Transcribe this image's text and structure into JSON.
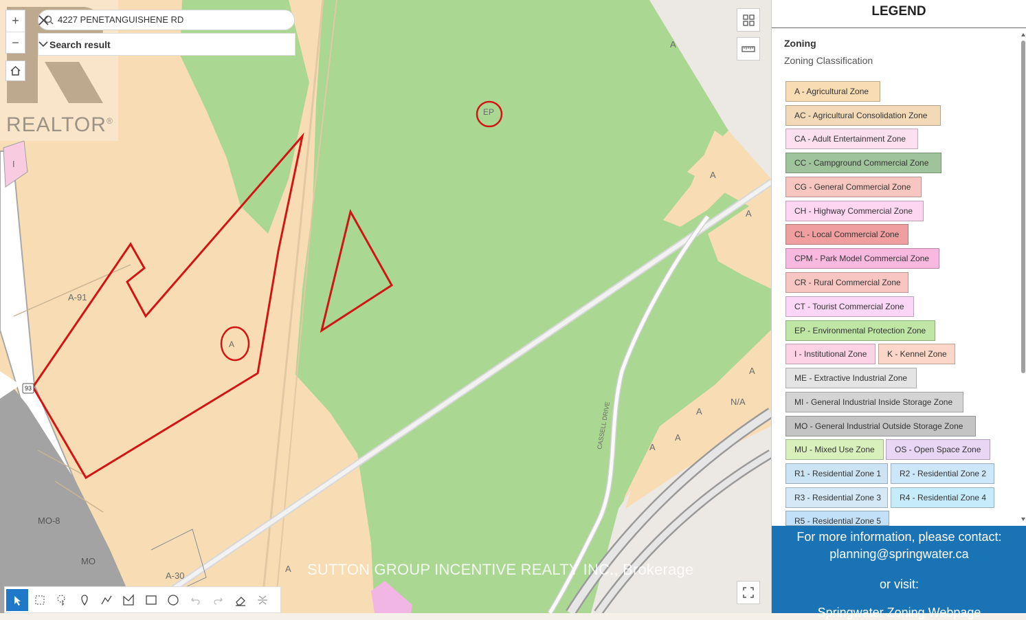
{
  "search": {
    "value": "4227 PENETANGUISHENE RD",
    "result_label": "Search result"
  },
  "zoom": {
    "in_label": "+",
    "out_label": "−"
  },
  "watermark": {
    "logo_text": "REALTOR",
    "logo_mark": "®",
    "brokerage": "SUTTON GROUP INCENTIVE REALTY INC., Brokerage"
  },
  "map_labels": {
    "ep": "EP",
    "a_circle": "A",
    "a91": "A-91",
    "road93": "93",
    "i": "I",
    "mo8": "MO-8",
    "mo": "MO",
    "a30": "A-30",
    "a_bottom": "A",
    "a_topright": "A",
    "a_right1": "A",
    "a_right2": "A",
    "a_right3": "A",
    "na": "N/A",
    "a_s1": "A",
    "a_s2": "A",
    "a_s3": "A",
    "cassell": "CASSELL DRIVE"
  },
  "legend": {
    "title": "LEGEND",
    "section": "Zoning",
    "subtitle": "Zoning Classification",
    "items": [
      {
        "label": "A - Agricultural Zone",
        "color": "#f7dcb4"
      },
      {
        "label": "AC - Agricultural Consolidation Zone",
        "color": "#f2d9b8"
      },
      {
        "label": "CA - Adult Entertainment Zone",
        "color": "#fde0f0"
      },
      {
        "label": "CC - Campground Commercial Zone",
        "color": "#9fc39a"
      },
      {
        "label": "CG - General Commercial Zone",
        "color": "#f8c6c0"
      },
      {
        "label": "CH - Highway Commercial Zone",
        "color": "#fdd6f2"
      },
      {
        "label": "CL - Local Commercial Zone",
        "color": "#ef9f9f"
      },
      {
        "label": "CPM - Park Model Commercial Zone",
        "color": "#f8b8e0"
      },
      {
        "label": "CR - Rural Commercial Zone",
        "color": "#f7c6c2"
      },
      {
        "label": "CT - Tourist Commercial Zone",
        "color": "#fbd6f6"
      },
      {
        "label": "EP - Environmental Protection Zone",
        "color": "#bfe6a4"
      },
      {
        "label": "I - Institutional Zone",
        "color": "#fcd2e4"
      },
      {
        "label": "K - Kennel Zone",
        "color": "#fcd6c6"
      },
      {
        "label": "ME - Extractive Industrial Zone",
        "color": "#e4e4e4"
      },
      {
        "label": "MI - General Industrial Inside Storage Zone",
        "color": "#d4d4d4"
      },
      {
        "label": "MO - General Industrial Outside Storage Zone",
        "color": "#c4c4c4"
      },
      {
        "label": "MU - Mixed Use Zone",
        "color": "#d8f0bc"
      },
      {
        "label": "OS - Open Space Zone",
        "color": "#e8d6f4"
      },
      {
        "label": "R1 - Residential Zone 1",
        "color": "#cce3f4"
      },
      {
        "label": "R2 - Residential Zone 2",
        "color": "#cce7fa"
      },
      {
        "label": "R3 - Residential Zone 3",
        "color": "#d4e8f6"
      },
      {
        "label": "R4 - Residential Zone 4",
        "color": "#c6ecfc"
      },
      {
        "label": "R5 - Residential Zone 5",
        "color": "#c2e0f8"
      }
    ]
  },
  "info": {
    "line1": "For more information, please contact:",
    "email": "planning@springwater.ca",
    "line2": "or visit:",
    "link": "Springwater Zoning Webpage"
  }
}
